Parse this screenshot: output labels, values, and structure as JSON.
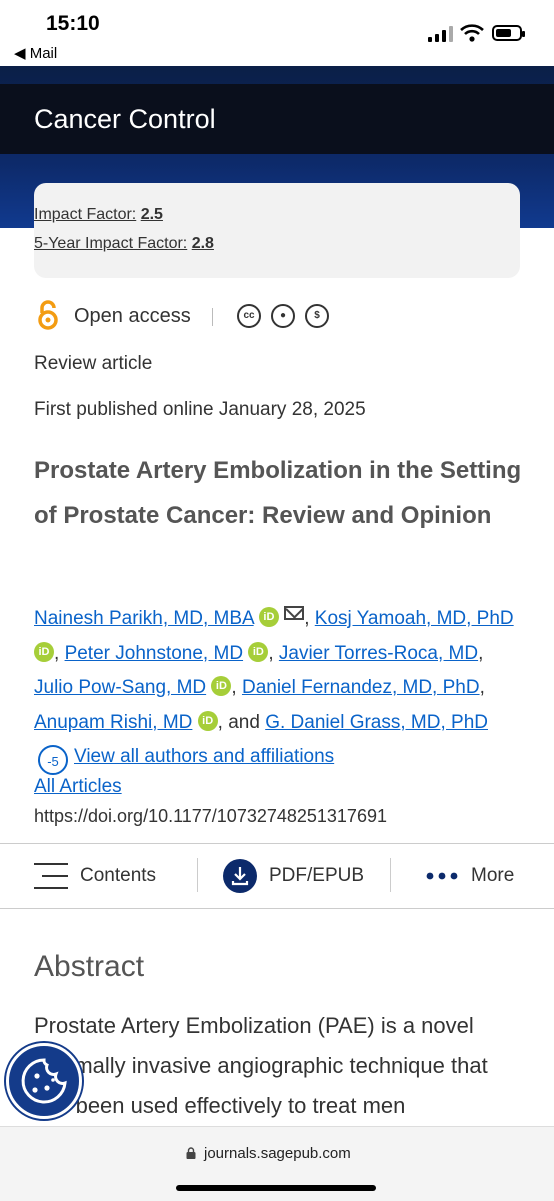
{
  "status_bar": {
    "time": "15:10",
    "back_app": "Mail"
  },
  "header": {
    "journal_title": "Cancer Control"
  },
  "impact": {
    "if_label": "Impact Factor:",
    "if_value": "2.5",
    "five_label": "5-Year Impact Factor:",
    "five_value": "2.8"
  },
  "access": {
    "label": "Open access",
    "icons": [
      "open-access-icon",
      "cc-icon",
      "cc-by-icon",
      "cc-nc-icon"
    ]
  },
  "article_type": "Review article",
  "published": "First published online January 28, 2025",
  "title": "Prostate Artery Embolization in the Setting of Prostate Cancer: Review and Opinion",
  "authors": [
    {
      "name": "Nainesh Parikh, MD, MBA",
      "orcid": true,
      "email": true
    },
    {
      "name": "Kosj Yamoah, MD, PhD",
      "orcid": true
    },
    {
      "name": "Peter Johnstone, MD",
      "orcid": true
    },
    {
      "name": "Javier Torres-Roca, MD",
      "orcid": false
    },
    {
      "name": "Julio Pow-Sang, MD",
      "orcid": true
    },
    {
      "name": "Daniel Fernandez, MD, PhD",
      "orcid": false
    },
    {
      "name": "Anupam Rishi, MD",
      "orcid": true
    },
    {
      "name": "G. Daniel Grass, MD, PhD",
      "orcid": false
    }
  ],
  "authors_more": {
    "count": "-5",
    "link": "View all authors and affiliations",
    "and": "and"
  },
  "all_articles": "All Articles",
  "doi": "https://doi.org/10.1177/10732748251317691",
  "toolbar": {
    "contents": "Contents",
    "pdf": "PDF/EPUB",
    "more": "More"
  },
  "abstract": {
    "heading": "Abstract",
    "text": "Prostate Artery Embolization (PAE) is a novel minimally invasive angiographic technique that has been used effectively to treat men"
  },
  "browser": {
    "url": "journals.sagepub.com"
  },
  "colors": {
    "header_bg": "#0a0f1c",
    "link": "#0a63c9",
    "orcid": "#a6ce39",
    "open_access": "#f39c12",
    "cookie_bg": "#143b8a"
  }
}
